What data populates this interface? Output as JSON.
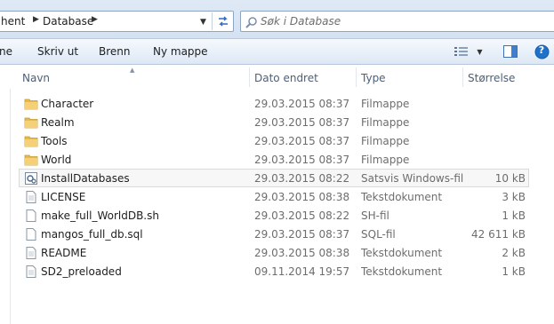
{
  "address_bar": {
    "crumbs": [
      "hent",
      "Database"
    ],
    "search_placeholder": "Søk i Database"
  },
  "toolbar": {
    "items": [
      "ne",
      "Skriv ut",
      "Brenn",
      "Ny mappe"
    ],
    "help_label": "?"
  },
  "columns": {
    "name": "Navn",
    "date": "Dato endret",
    "type": "Type",
    "size": "Størrelse"
  },
  "files": [
    {
      "name": "Character",
      "date": "29.03.2015 08:37",
      "type": "Filmappe",
      "size": "",
      "icon": "folder-icon"
    },
    {
      "name": "Realm",
      "date": "29.03.2015 08:37",
      "type": "Filmappe",
      "size": "",
      "icon": "folder-icon"
    },
    {
      "name": "Tools",
      "date": "29.03.2015 08:37",
      "type": "Filmappe",
      "size": "",
      "icon": "folder-icon"
    },
    {
      "name": "World",
      "date": "29.03.2015 08:37",
      "type": "Filmappe",
      "size": "",
      "icon": "folder-icon"
    },
    {
      "name": "InstallDatabases",
      "date": "29.03.2015 08:22",
      "type": "Satsvis Windows-fil",
      "size": "10 kB",
      "icon": "batch-file-icon"
    },
    {
      "name": "LICENSE",
      "date": "29.03.2015 08:38",
      "type": "Tekstdokument",
      "size": "3 kB",
      "icon": "document-icon"
    },
    {
      "name": "make_full_WorldDB.sh",
      "date": "29.03.2015 08:22",
      "type": "SH-fil",
      "size": "1 kB",
      "icon": "document-icon"
    },
    {
      "name": "mangos_full_db.sql",
      "date": "29.03.2015 08:37",
      "type": "SQL-fil",
      "size": "42 611 kB",
      "icon": "document-icon"
    },
    {
      "name": "README",
      "date": "29.03.2015 08:38",
      "type": "Tekstdokument",
      "size": "2 kB",
      "icon": "document-icon"
    },
    {
      "name": "SD2_preloaded",
      "date": "09.11.2014 19:57",
      "type": "Tekstdokument",
      "size": "1 kB",
      "icon": "document-icon"
    }
  ],
  "colors": {
    "folder": "#e8b94a",
    "accent": "#1e70c9",
    "muted_text": "#6d6d6d"
  }
}
